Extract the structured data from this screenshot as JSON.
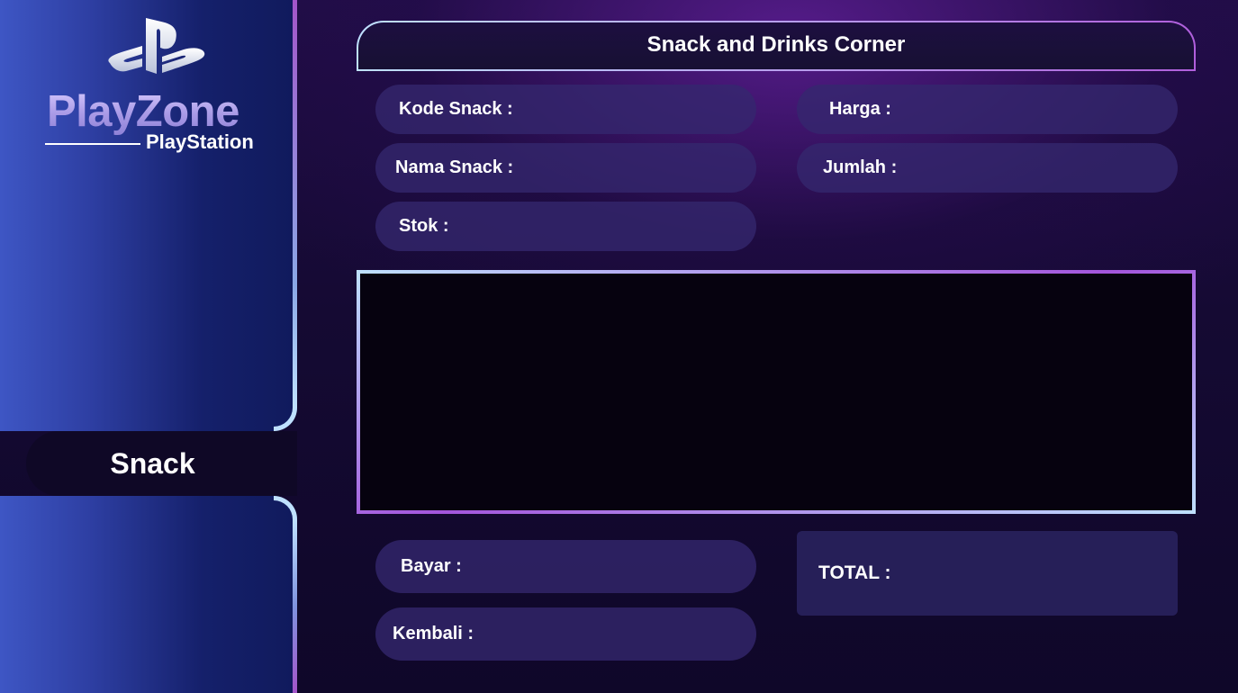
{
  "sidebar": {
    "brand_title": "PlayZone",
    "brand_subtitle": "PlayStation",
    "nav_items": [
      {
        "label": "Snack",
        "active": true
      }
    ]
  },
  "header": {
    "title": "Snack and Drinks Corner"
  },
  "form": {
    "kode_snack": {
      "label": "Kode Snack :",
      "value": ""
    },
    "nama_snack": {
      "label": "Nama Snack :",
      "value": ""
    },
    "stok": {
      "label": "Stok :",
      "value": ""
    },
    "harga": {
      "label": "Harga :",
      "value": ""
    },
    "jumlah": {
      "label": "Jumlah :",
      "value": ""
    }
  },
  "table": {
    "rows": []
  },
  "payment": {
    "bayar": {
      "label": "Bayar :",
      "value": ""
    },
    "kembali": {
      "label": "Kembali :",
      "value": ""
    },
    "total": {
      "label": "TOTAL :",
      "value": ""
    }
  },
  "colors": {
    "sidebar_gradient_start": "#3e56c4",
    "sidebar_gradient_end": "#101a5c",
    "accent_light": "#bfe1ff",
    "accent_purple": "#a355dc",
    "background": "#150a33",
    "field_bg": "#34286e",
    "table_bg": "#06020f"
  },
  "icons": {
    "logo": "playstation-logo-icon"
  }
}
